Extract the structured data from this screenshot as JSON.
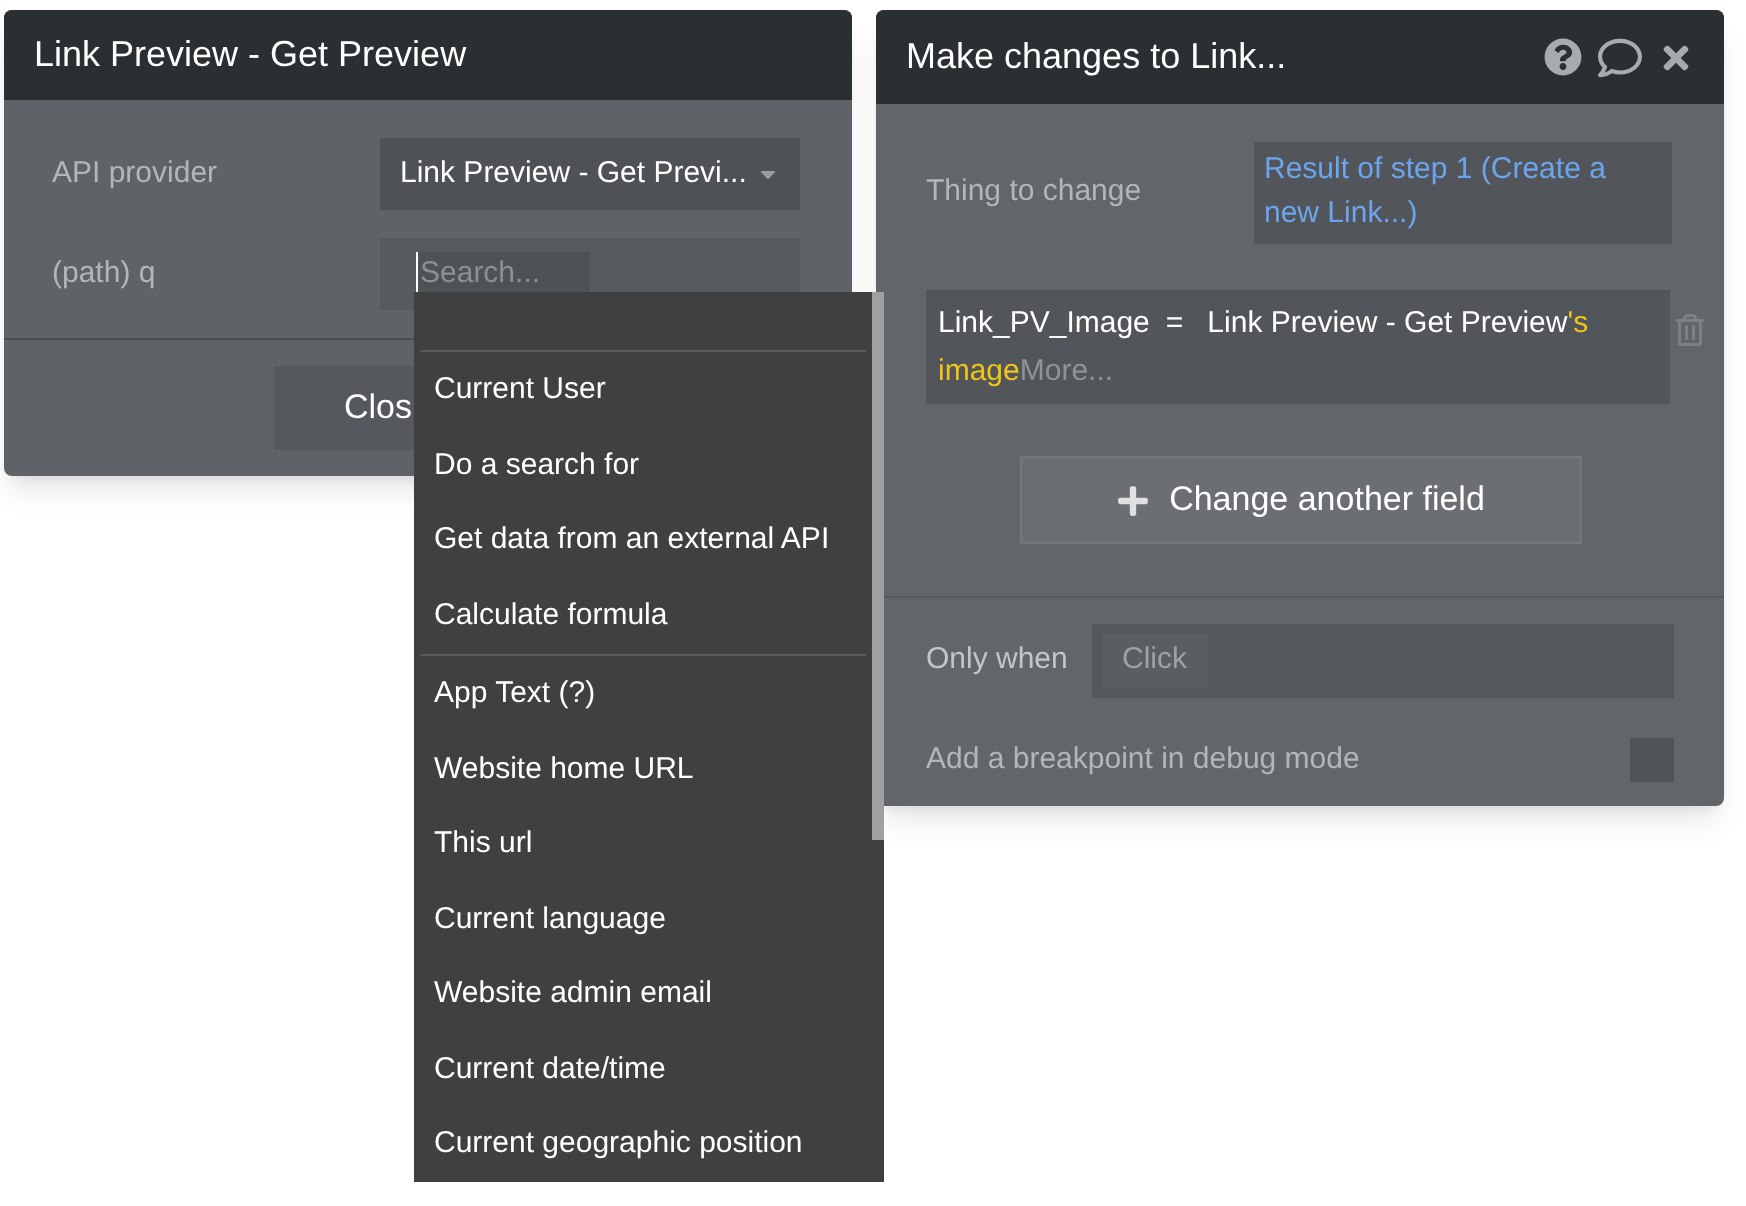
{
  "api_dialog": {
    "title": "Link Preview - Get Preview",
    "fields": [
      {
        "label": "API provider",
        "kind": "select",
        "value": "Link Preview - Get Previ..."
      },
      {
        "label": "(path) q",
        "kind": "search",
        "placeholder": "Search..."
      }
    ],
    "close_button": "Clos"
  },
  "source_menu": {
    "groups": [
      [
        "Current User",
        "Do a search for",
        "Get data from an external API",
        "Calculate formula"
      ],
      [
        "App Text (?)",
        "Website home URL",
        "This url",
        "Current language",
        "Website admin email",
        "Current date/time",
        "Current geographic position"
      ]
    ]
  },
  "action_dialog": {
    "title": "Make changes to Link...",
    "thing_label": "Thing to change",
    "thing_value": "Result of step 1 (Create a new Link...)",
    "assignment": {
      "field": "Link_PV_Image",
      "operator": "=",
      "parts": [
        {
          "kind": "source",
          "text": "Link Preview - Get Preview"
        },
        {
          "kind": "property",
          "text": "'s image"
        }
      ],
      "more": "More..."
    },
    "add_button": "Change another field",
    "only_when_label": "Only when",
    "only_when_placeholder": "Click",
    "breakpoint_label": "Add a breakpoint in debug mode",
    "breakpoint_checked": false
  }
}
